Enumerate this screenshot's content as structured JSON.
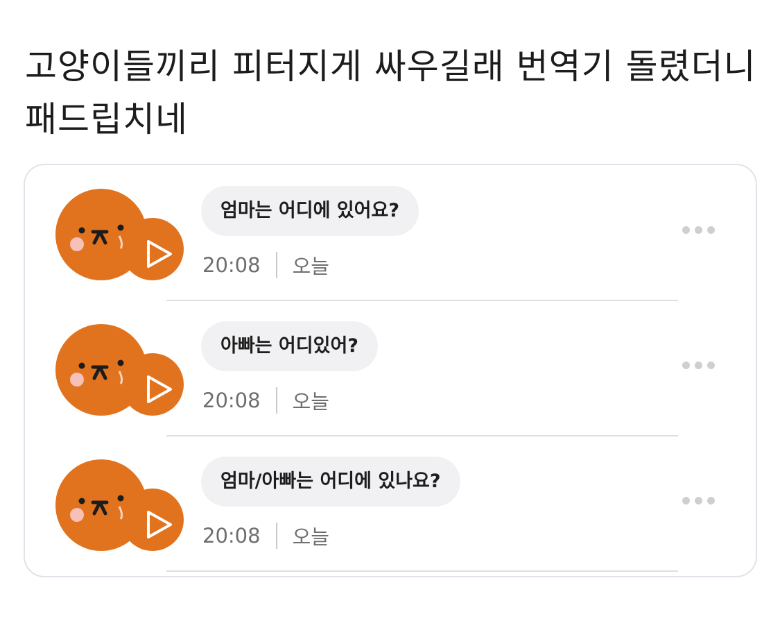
{
  "post": {
    "title": "고양이들끼리 피터지게 싸우길래 번역기 돌렸더니 패드립치네"
  },
  "translations": [
    {
      "text": "엄마는 어디에 있어요?",
      "time": "20:08",
      "day": "오늘"
    },
    {
      "text": "아빠는 어디있어?",
      "time": "20:08",
      "day": "오늘"
    },
    {
      "text": "엄마/아빠는 어디에 있나요?",
      "time": "20:08",
      "day": "오늘"
    }
  ],
  "icons": {
    "avatar": "cat-face-icon",
    "play": "play-icon",
    "more": "more-dots-icon"
  },
  "colors": {
    "avatar_orange": "#e2731e",
    "bubble_bg": "#f1f1f3",
    "card_border": "#e2e2ea"
  }
}
